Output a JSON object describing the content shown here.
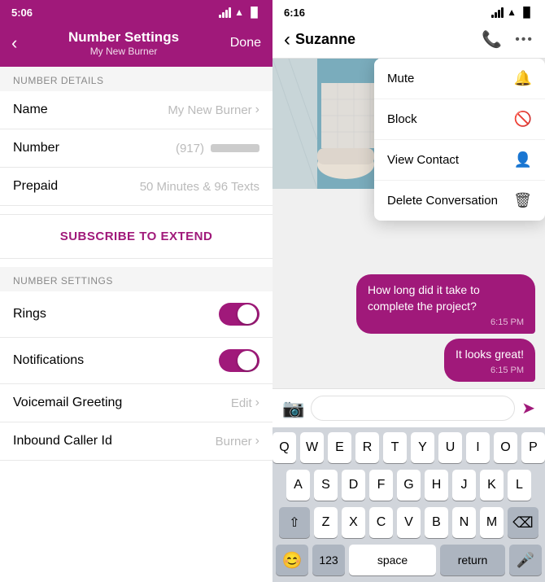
{
  "left": {
    "status_bar": {
      "time": "5:06",
      "arrow_icon": "↗"
    },
    "nav": {
      "back_label": "‹",
      "title": "Number Settings",
      "subtitle": "My New Burner",
      "done_label": "Done"
    },
    "section_number_details": "NUMBER DETAILS",
    "rows_details": [
      {
        "label": "Name",
        "value": "My New Burner",
        "type": "chevron"
      },
      {
        "label": "Number",
        "value": "(917)",
        "type": "masked"
      },
      {
        "label": "Prepaid",
        "value": "50 Minutes & 96 Texts",
        "type": "none"
      }
    ],
    "subscribe_label": "SUBSCRIBE TO EXTEND",
    "section_number_settings": "NUMBER SETTINGS",
    "rows_settings": [
      {
        "label": "Rings",
        "type": "toggle",
        "on": true
      },
      {
        "label": "Notifications",
        "type": "toggle",
        "on": true
      },
      {
        "label": "Voicemail Greeting",
        "value": "Edit",
        "type": "chevron"
      },
      {
        "label": "Inbound Caller Id",
        "value": "Burner",
        "type": "chevron"
      }
    ]
  },
  "right": {
    "status_bar": {
      "time": "6:16",
      "arrow_icon": "↗"
    },
    "nav": {
      "back_label": "‹",
      "contact_name": "Suzanne",
      "phone_icon": "phone",
      "more_icon": "..."
    },
    "dropdown": {
      "items": [
        {
          "label": "Mute",
          "icon": "🔔"
        },
        {
          "label": "Block",
          "icon": "🚫"
        },
        {
          "label": "View Contact",
          "icon": "👤"
        },
        {
          "label": "Delete Conversation",
          "icon": "🗑"
        }
      ]
    },
    "messages": [
      {
        "text": "How long did it take to complete the project?",
        "time": "6:15 PM"
      },
      {
        "text": "It looks great!",
        "time": "6:15 PM"
      }
    ],
    "input": {
      "placeholder": "",
      "send_icon": "➤"
    },
    "keyboard": {
      "rows": [
        [
          "Q",
          "W",
          "E",
          "R",
          "T",
          "Y",
          "U",
          "I",
          "O",
          "P"
        ],
        [
          "A",
          "S",
          "D",
          "F",
          "G",
          "H",
          "J",
          "K",
          "L"
        ],
        [
          "Z",
          "X",
          "C",
          "V",
          "B",
          "N",
          "M"
        ]
      ],
      "num_label": "123",
      "space_label": "space",
      "return_label": "return"
    }
  }
}
